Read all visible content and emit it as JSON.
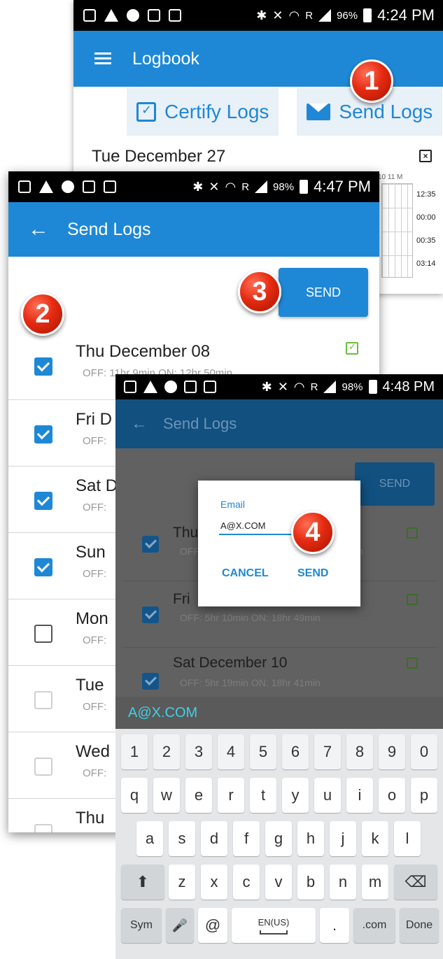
{
  "phone1": {
    "status": {
      "battery": "96%",
      "time": "4:24 PM",
      "signal_tag": "R"
    },
    "title": "Logbook",
    "certify_label": "Certify Logs",
    "send_label": "Send Logs",
    "day_header": "Tue  December 27",
    "grid_ticks": "10  11  M",
    "totals": [
      "12:35",
      "00:00",
      "00:35",
      "03:14"
    ]
  },
  "phone2": {
    "status": {
      "battery": "98%",
      "time": "4:47 PM",
      "signal_tag": "R"
    },
    "title": "Send Logs",
    "send_label": "SEND",
    "rows": [
      {
        "title": "Thu December 08",
        "sub": "OFF: 11hr 9min   ON: 12hr 50min",
        "checked": true
      },
      {
        "title": "Fri D",
        "sub": "OFF:",
        "checked": true
      },
      {
        "title": "Sat D",
        "sub": "OFF:",
        "checked": true
      },
      {
        "title": "Sun",
        "sub": "OFF:",
        "checked": true
      },
      {
        "title": "Mon",
        "sub": "OFF:",
        "checked": false
      },
      {
        "title": "Tue",
        "sub": "OFF:",
        "checked": false
      },
      {
        "title": "Wed",
        "sub": "OFF:",
        "checked": false
      },
      {
        "title": "Thu",
        "sub": "",
        "checked": false
      }
    ]
  },
  "phone3": {
    "status": {
      "battery": "98%",
      "time": "4:48 PM",
      "signal_tag": "R"
    },
    "title": "Send Logs",
    "send_label": "SEND",
    "rows": [
      {
        "title": "Thu",
        "sub": "OFF",
        "tail": "n"
      },
      {
        "title": "Fri",
        "sub": "OFF: 5hr 10min   ON: 18hr 49min",
        "tail": ""
      },
      {
        "title": "Sat December 10",
        "sub": "OFF: 5hr 19min   ON: 18hr 41min",
        "tail": ""
      }
    ],
    "dialog": {
      "label": "Email",
      "value": "A@X.COM",
      "cancel": "CANCEL",
      "send": "SEND"
    },
    "suggestion": "A@X.COM",
    "keyboard": {
      "numbers": [
        "1",
        "2",
        "3",
        "4",
        "5",
        "6",
        "7",
        "8",
        "9",
        "0"
      ],
      "row1": [
        "q",
        "w",
        "e",
        "r",
        "t",
        "y",
        "u",
        "i",
        "o",
        "p"
      ],
      "row2": [
        "a",
        "s",
        "d",
        "f",
        "g",
        "h",
        "j",
        "k",
        "l"
      ],
      "row3": [
        "z",
        "x",
        "c",
        "v",
        "b",
        "n",
        "m"
      ],
      "sym": "Sym",
      "at": "@",
      "lang": "EN(US)",
      "dot": ".",
      "dotcom": ".com",
      "done": "Done",
      "shift": "⬆",
      "backspace": "⌫",
      "mic": "🎤"
    }
  },
  "badges": [
    "1",
    "2",
    "3",
    "4"
  ],
  "colors": {
    "accent": "#1e88d6",
    "badge": "#e52b12",
    "cert_green": "#6abf3e"
  }
}
